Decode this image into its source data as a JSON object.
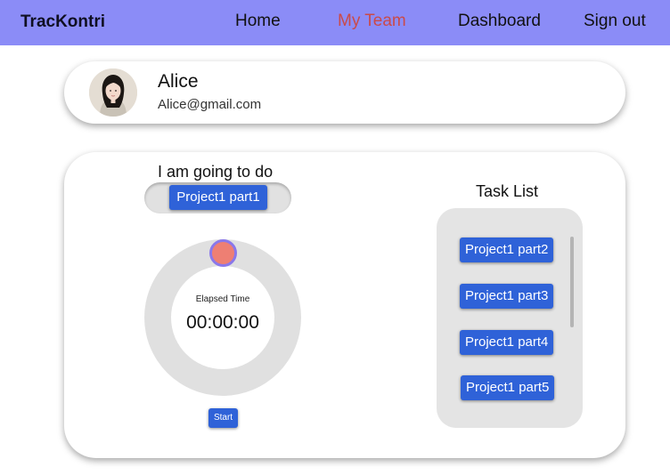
{
  "nav": {
    "brand": "TracKontri",
    "links": [
      {
        "label": "Home"
      },
      {
        "label": "My Team",
        "color": "#ca4a4a"
      },
      {
        "label": "Dashboard"
      },
      {
        "label": "Sign out"
      }
    ],
    "background": "#8b8cf7"
  },
  "profile": {
    "name": "Alice",
    "email": "Alice@gmail.com",
    "avatar_icon": "user-avatar-photo"
  },
  "timer": {
    "going_to_do_label": "I am going to do",
    "selected_task": "Project1 part1",
    "elapsed_label": "Elapsed Time",
    "elapsed_value": "00:00:00",
    "start_label": "Start"
  },
  "task_list": {
    "title": "Task List",
    "items": [
      {
        "label": "Project1 part2"
      },
      {
        "label": "Project1 part3"
      },
      {
        "label": "Project1 part4"
      },
      {
        "label": "Project1 part5"
      }
    ]
  },
  "colors": {
    "button": "#2f62d8",
    "handle": "#ee7f73",
    "handle_border": "#8a78ea",
    "active_nav": "#ca4a4a"
  }
}
